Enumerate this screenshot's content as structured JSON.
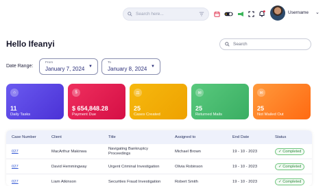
{
  "header": {
    "search_placeholder": "Search here...",
    "username": "Username"
  },
  "greeting": "Hello Ifeanyi",
  "search": {
    "placeholder": "Search"
  },
  "date_range": {
    "label": "Date Range:",
    "from_label": "From",
    "from_value": "January 7, 2024",
    "to_label": "To",
    "to_value": "January 8, 2024"
  },
  "cards": [
    {
      "value": "11",
      "label": "Daily Tasks",
      "color": "#5b3fe6",
      "icon": "home-icon"
    },
    {
      "value": "654,848.28",
      "currency": "$",
      "label": "Payment Due",
      "color": "#e3174f",
      "icon": "money-icon"
    },
    {
      "value": "25",
      "label": "Cases Created",
      "color": "#f2a900",
      "icon": "gavel-icon"
    },
    {
      "value": "25",
      "label": "Returned Mails",
      "color": "#43b96a",
      "icon": "mail-icon"
    },
    {
      "value": "25",
      "label": "Not Mailed Out",
      "color": "#ff7a1a",
      "icon": "mail-x-icon"
    }
  ],
  "table": {
    "headers": [
      "Case Number",
      "Client",
      "Title",
      "Assigned to",
      "End Date",
      "Status"
    ],
    "rows": [
      {
        "case": "027",
        "client": "MacArthur Makinwa",
        "title": "Navigating Bankruptcy Proceedings",
        "assigned": "Michael Brown",
        "end": "19 - 10 - 2023",
        "status": "Completed"
      },
      {
        "case": "027",
        "client": "David Hemmingway",
        "title": "Urgent Criminal Investigation",
        "assigned": "Olivia Robinson",
        "end": "19 - 10 - 2023",
        "status": "Completed"
      },
      {
        "case": "027",
        "client": "Liam Atkinson",
        "title": "Securities Fraud Investigation",
        "assigned": "Robert Smith",
        "end": "19 - 10 - 2023",
        "status": "Completed"
      }
    ]
  }
}
